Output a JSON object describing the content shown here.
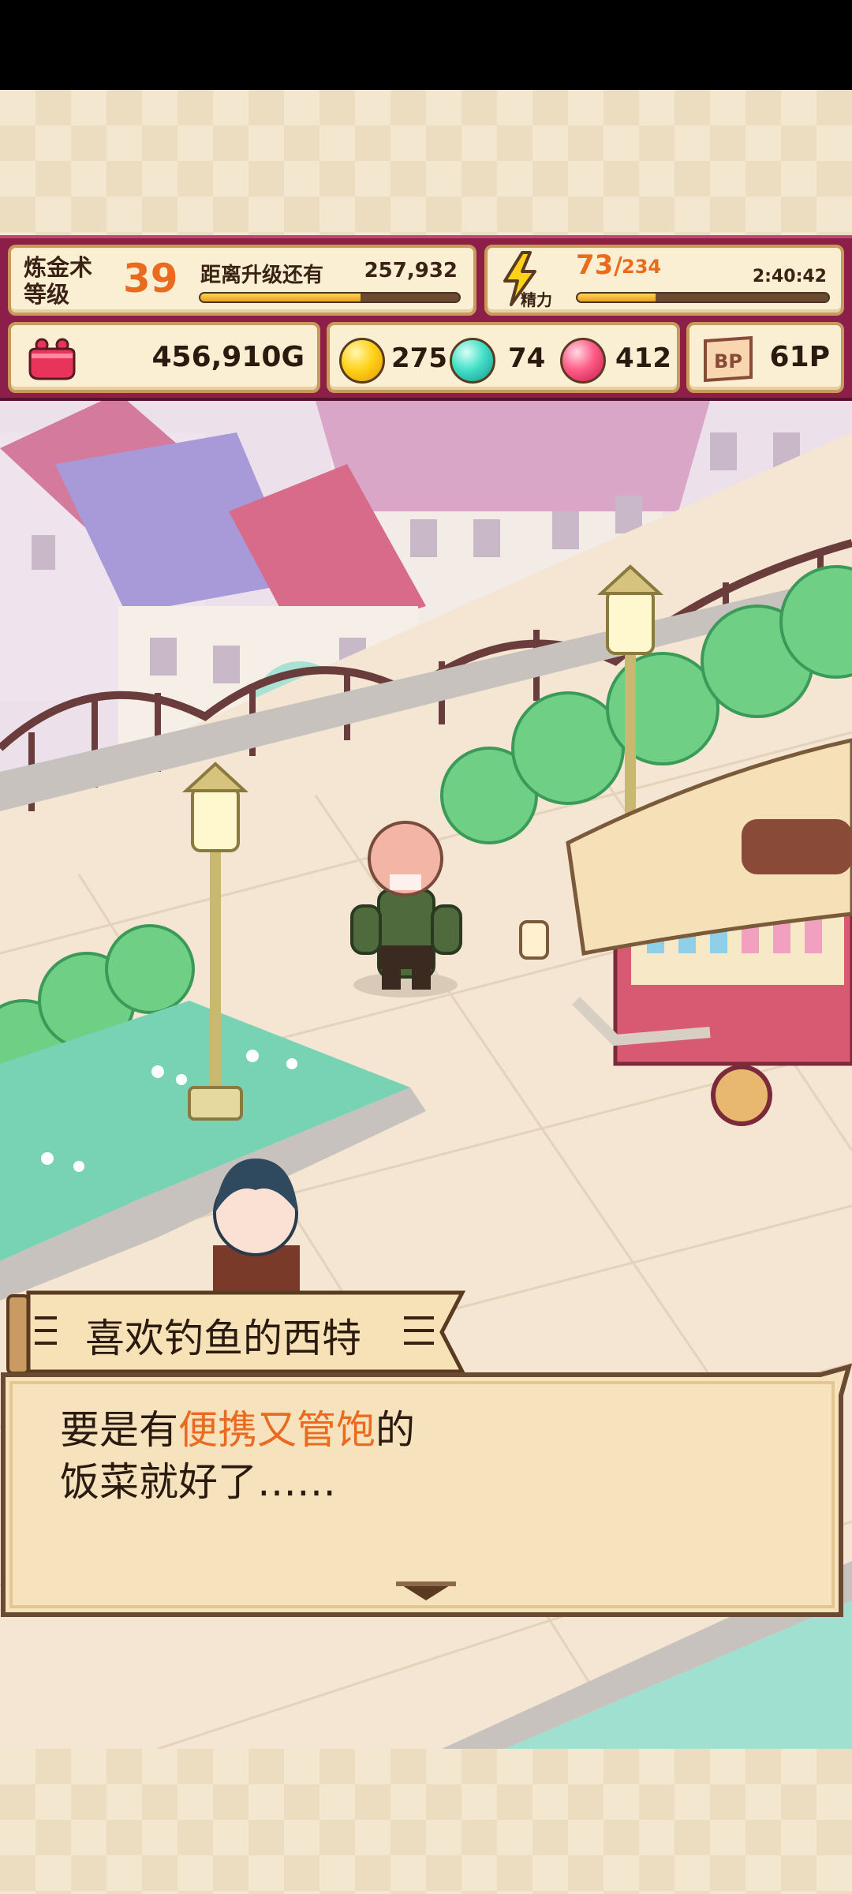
{
  "hud": {
    "level_label": "炼金术\n等级",
    "level_value": "39",
    "next_label": "距离升级还有",
    "exp_remaining": "257,932",
    "exp_progress": 0.62,
    "stamina_label": "精力",
    "stamina_current": "73",
    "stamina_max": "234",
    "stamina_progress": 0.31,
    "stamina_timer": "2:40:42",
    "gold": "456,910G",
    "orb_yellow": "275",
    "orb_teal": "74",
    "orb_pink": "412",
    "bp_icon_text": "BP",
    "bp_value": "61P"
  },
  "dialogue": {
    "speaker": "喜欢钓鱼的西特",
    "line1_prefix": "要是有",
    "line1_highlight": "便携又管饱",
    "line1_suffix": "的",
    "line2": "饭菜就好了……"
  },
  "colors": {
    "hud_frame": "#8c1f4a",
    "panel": "#fbefd3",
    "accent_orange": "#ea6a1f",
    "dialog_bg": "#f6e2bc"
  },
  "icons": [
    "lightning-icon",
    "purse-icon",
    "yellow-orb-icon",
    "teal-orb-icon",
    "pink-orb-icon",
    "bp-ticket-icon",
    "advance-arrow-icon"
  ]
}
